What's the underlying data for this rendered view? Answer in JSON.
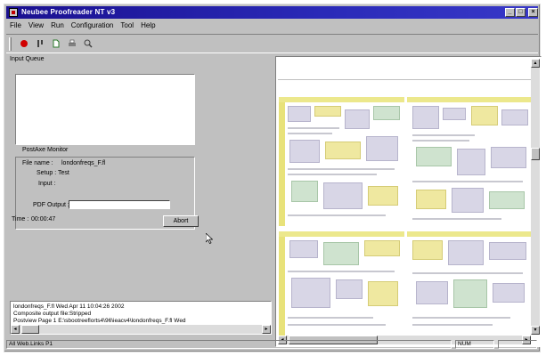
{
  "window": {
    "title": "Neubee Proofreader NT v3",
    "controls": {
      "minimize": "_",
      "maximize": "□",
      "close": "×"
    }
  },
  "menu": [
    "File",
    "View",
    "Run",
    "Configuration",
    "Tool",
    "Help"
  ],
  "toolbar": {
    "buttons": [
      {
        "name": "record-icon",
        "color": "#d00000"
      },
      {
        "name": "pause-icon",
        "color": "#404040"
      },
      {
        "name": "document-icon",
        "color": "#2a7a2a"
      },
      {
        "name": "print-icon",
        "color": "#404040"
      },
      {
        "name": "zoom-icon",
        "color": "#404040"
      }
    ]
  },
  "left": {
    "header": "Input Queue",
    "monitor_title": "PostAxe Monitor",
    "file_name_label": "File name :",
    "file_name_value": "londonfreqs_F.fl",
    "setup_label": "Setup : Test",
    "input_label": "Input :",
    "pdf_output_label": "PDF Output :",
    "pdf_output_value": "",
    "time_label": "Time :",
    "time_value": "00:00:47",
    "abort_label": "Abort"
  },
  "log": {
    "lines": [
      "londonfreqs_F.fl        Wed Apr 11 10:04:26 2002",
      "Composite output file:Stripped",
      "Postview Page 1 E:\\sbootreeflorts4\\96\\ieacv4\\londonfreqs_F.fl Wed"
    ]
  },
  "statusbar": {
    "left": "All Web.Links P1",
    "right": "NUM"
  },
  "colors": {
    "titlebar": "#1a1090",
    "page_accent": "#e8e27a"
  }
}
